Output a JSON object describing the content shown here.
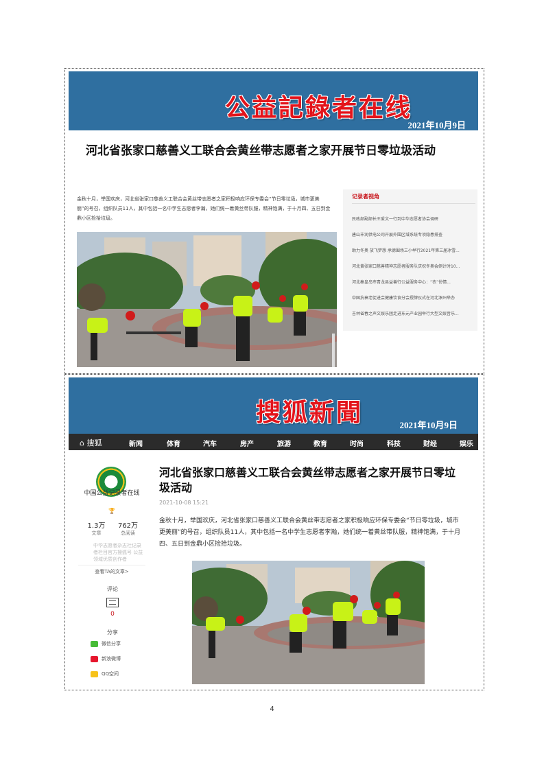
{
  "top": {
    "masthead": "公益記錄者在线",
    "date": "2021年10月9日",
    "title": "河北省张家口慈善义工联合会黄丝带志愿者之家开展节日零垃圾活动",
    "body": "金秋十月，举国欢庆，河北省张家口慈善义工联合会黄丝带志愿者之家积极响应环保专委会“节日零垃圾，城市更美丽”的号召，组织队员11人，其中包括一名中学生志愿者李瀚，她们统一着黄丝带队服，精神饱满，于十月四、五日到金鼎小区捡拾垃圾。",
    "sidebar": {
      "heading": "记录者视角",
      "items": [
        "民政部副部长王爱文一行到中华志愿者协会调研",
        "唐山丰润供电公司开展外围区域系统专项隐患排查",
        "助力冬奥 放飞梦想 承德围场三小举行2021年第三届冰雪...",
        "河北黄张家口慈善精神志愿者服务队庆祝冬奥会倒计时10...",
        "河北秦皇岛市青龙县益善行公益服务中心：“衣”份情...",
        "中国抗衰老促进会健康饮食分会授牌仪式在河北涿州举办",
        "吉林省春之声文娱乐团走进东元产业园举行大型文娱音乐..."
      ]
    }
  },
  "bottom": {
    "masthead": "搜狐新聞",
    "date": "2021年10月9日",
    "nav": {
      "logo": "⌂ 搜狐",
      "items": [
        "新闻",
        "体育",
        "汽车",
        "房产",
        "旅游",
        "教育",
        "时尚",
        "科技",
        "财经",
        "娱乐"
      ]
    },
    "author": {
      "name": "中国公益记录者在线",
      "badge": "🏆",
      "articles_num": "1.3万",
      "articles_label": "文章",
      "views_num": "762万",
      "views_label": "总阅读",
      "desc": "中华志愿者杂志社记录者栏目官方搜狐号 公益领域优质创作者",
      "more": "查看TA的文章>"
    },
    "tools": {
      "comment_label": "评论",
      "comment_count": "0",
      "share_label": "分享",
      "share_items": [
        "微信分享",
        "新浪微博",
        "QQ空间"
      ]
    },
    "title": "河北省张家口慈善义工联合会黄丝带志愿者之家开展节日零垃圾活动",
    "time": "2021-10-08 15:21",
    "body": "金秋十月，举国欢庆，河北省张家口慈善义工联合会黄丝带志愿者之家积极响应环保专委会“节日零垃圾，城市更美丽”的号召，组织队员11人，其中包括一名中学生志愿者李瀚，她们统一着黄丝带队服，精神饱满，于十月四、五日到金鼎小区捡拾垃圾。"
  },
  "page_number": "4",
  "colors": {
    "banner": "#2f6fa0",
    "masthead_red": "#e3141b",
    "vest_green": "#c8f217",
    "navbar": "#2b2b2b"
  }
}
